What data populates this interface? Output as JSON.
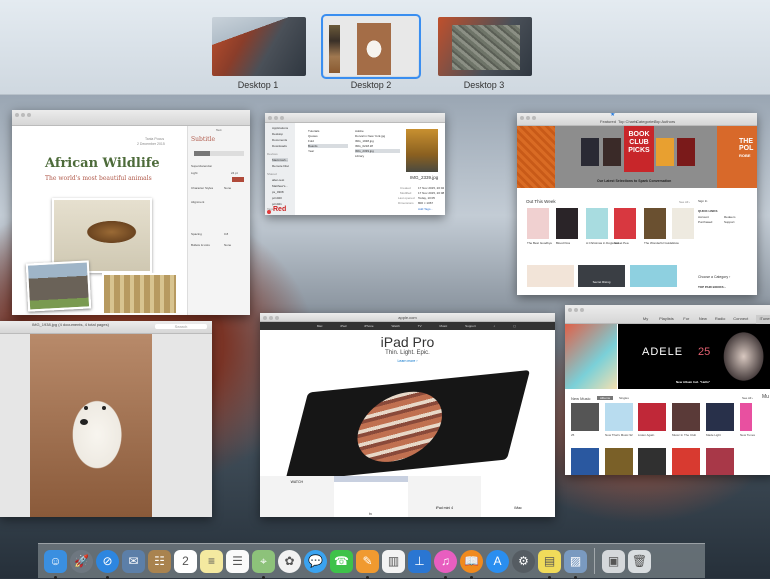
{
  "spaces": [
    {
      "label": "Desktop 1",
      "selected": false
    },
    {
      "label": "Desktop 2",
      "selected": true
    },
    {
      "label": "Desktop 3",
      "selected": false
    }
  ],
  "pages": {
    "author": "Tania Pocus",
    "date": "2 December 2015",
    "title": "African Wildlife",
    "subtitle": "The world's most beautiful animals",
    "inspector_tab": "Text",
    "style": "Subtitle",
    "font": "Superclarendon",
    "weight": "Light",
    "size": "24 pt",
    "char_styles": "Character Styles",
    "char_styles_value": "None",
    "alignment": "Alignment",
    "spacing": "Spacing",
    "spacing_value": "0.8",
    "bullets": "Bullets & Lists",
    "bullets_value": "None"
  },
  "finder": {
    "sidebar": [
      "Applications",
      "Desktop",
      "Documents",
      "Downloads"
    ],
    "devices_head": "Devices",
    "devices": [
      "Macintosh...",
      "Remote Disc"
    ],
    "shared_head": "Shared",
    "shared": [
      "allen-test",
      "Matthew's...",
      "ps_0308",
      "pc1020",
      "pc1021"
    ],
    "tags_head": "Tags",
    "tags": [
      "Red"
    ],
    "col1": [
      "Tutorials",
      "Quotes",
      "Fold",
      "Boards",
      "Year"
    ],
    "col2": [
      "Adobe",
      "Dorval in New York.jpg",
      "IMG_1938.jpg",
      "IMG_0218.tiff",
      "IMG_2339.jpg",
      "Library"
    ],
    "preview_name": "IMG_2339.jpg",
    "info": [
      [
        "Created",
        "17 Nov 2015, 20:02"
      ],
      [
        "Modified",
        "17 Nov 2015, 20:08"
      ],
      [
        "Last opened",
        "Today, 10:05"
      ],
      [
        "Dimensions",
        "800 × 1067"
      ]
    ],
    "more_tags": "Add Tags..."
  },
  "ibooks": {
    "tabs": [
      "Featured",
      "Top Charts",
      "Categories",
      "Top Authors"
    ],
    "banner_title": "BOOK CLUB PICKS",
    "banner_caption": "Our Latest Selections to Spark Conversation",
    "right_banner": "THE POL",
    "right_banner_sub": "ROBE",
    "section": "Out This Week",
    "see_all": "See All ›",
    "books": [
      "The Best Goodbye",
      "Blood Kiss",
      "A Christmas in Dogwood",
      "Sweet Pea",
      "The Wonderful Guide",
      "Glow"
    ],
    "sign_in": "Sign In",
    "quick_links": "QUICK LINKS",
    "links": [
      "Account",
      "Redeem",
      "Purchased",
      "Support"
    ],
    "choose": "Choose a Category ›",
    "top_paid": "TOP PAID BOOKS ›",
    "promo": "Secret Rising"
  },
  "preview": {
    "title": "IMG_1938.jpg (4 documents, 4 total pages)",
    "search": "Search"
  },
  "safari": {
    "url": "apple.com",
    "nav": [
      "Mac",
      "iPad",
      "iPhone",
      "Watch",
      "TV",
      "Music",
      "Support"
    ],
    "headline": "iPad Pro",
    "tagline": "Thin. Light. Epic.",
    "learn": "Learn more ›",
    "tiles": [
      "WATCH",
      "tv",
      "iPad mini 4",
      "iMac"
    ]
  },
  "itunes": {
    "tabs": [
      "My Music",
      "Playlists",
      "For You",
      "New",
      "Radio",
      "Connect",
      "iTunes Store"
    ],
    "banner": "ADELE",
    "banner_num": "25",
    "banner_caption": "New Album Incl. \"Hello\"",
    "section": "New Music",
    "filter1": "Albums",
    "filter2": "Singles",
    "see_all": "See All ›",
    "albums": [
      "25",
      "Now That's Music 92",
      "Listen Again",
      "Music In The Club",
      "Made Light",
      "New Tunes"
    ],
    "side": "Mu"
  },
  "dock": [
    {
      "name": "finder",
      "color": "#3a8fe0",
      "glyph": "☺",
      "running": true
    },
    {
      "name": "launchpad",
      "color": "#6e7780",
      "glyph": "🚀",
      "running": false
    },
    {
      "name": "safari",
      "color": "#2d86e0",
      "glyph": "⊘",
      "running": true
    },
    {
      "name": "mail",
      "color": "#5c7fa8",
      "glyph": "✉",
      "running": false
    },
    {
      "name": "contacts",
      "color": "#a9834f",
      "glyph": "☷",
      "running": false
    },
    {
      "name": "calendar",
      "color": "#ffffff",
      "glyph": "2",
      "running": false
    },
    {
      "name": "notes",
      "color": "#f4e9a0",
      "glyph": "≡",
      "running": false
    },
    {
      "name": "reminders",
      "color": "#fafafa",
      "glyph": "☰",
      "running": false
    },
    {
      "name": "maps",
      "color": "#8dc27a",
      "glyph": "⌖",
      "running": true
    },
    {
      "name": "photos",
      "color": "#f2f2f2",
      "glyph": "✿",
      "running": false
    },
    {
      "name": "messages",
      "color": "#3aa3f0",
      "glyph": "💬",
      "running": false
    },
    {
      "name": "facetime",
      "color": "#3ec24a",
      "glyph": "☎",
      "running": false
    },
    {
      "name": "pages",
      "color": "#f09a30",
      "glyph": "✎",
      "running": true
    },
    {
      "name": "numbers",
      "color": "#f3f3f3",
      "glyph": "▥",
      "running": false
    },
    {
      "name": "keynote",
      "color": "#2a76d2",
      "glyph": "⊥",
      "running": false
    },
    {
      "name": "itunes",
      "color": "#e85ec0",
      "glyph": "♫",
      "running": true
    },
    {
      "name": "ibooks",
      "color": "#f08a1e",
      "glyph": "📖",
      "running": true
    },
    {
      "name": "app-store",
      "color": "#2a8ef0",
      "glyph": "A",
      "running": false
    },
    {
      "name": "system-preferences",
      "color": "#555c62",
      "glyph": "⚙",
      "running": false
    },
    {
      "name": "stickies",
      "color": "#f0db5a",
      "glyph": "▤",
      "running": true
    },
    {
      "name": "preview",
      "color": "#7a9ac0",
      "glyph": "▨",
      "running": true
    },
    {
      "name": "downloads-stack",
      "color": "#d5d8db",
      "glyph": "▣",
      "running": false
    },
    {
      "name": "trash",
      "color": "#d9dde0",
      "glyph": "🗑",
      "running": false
    }
  ]
}
